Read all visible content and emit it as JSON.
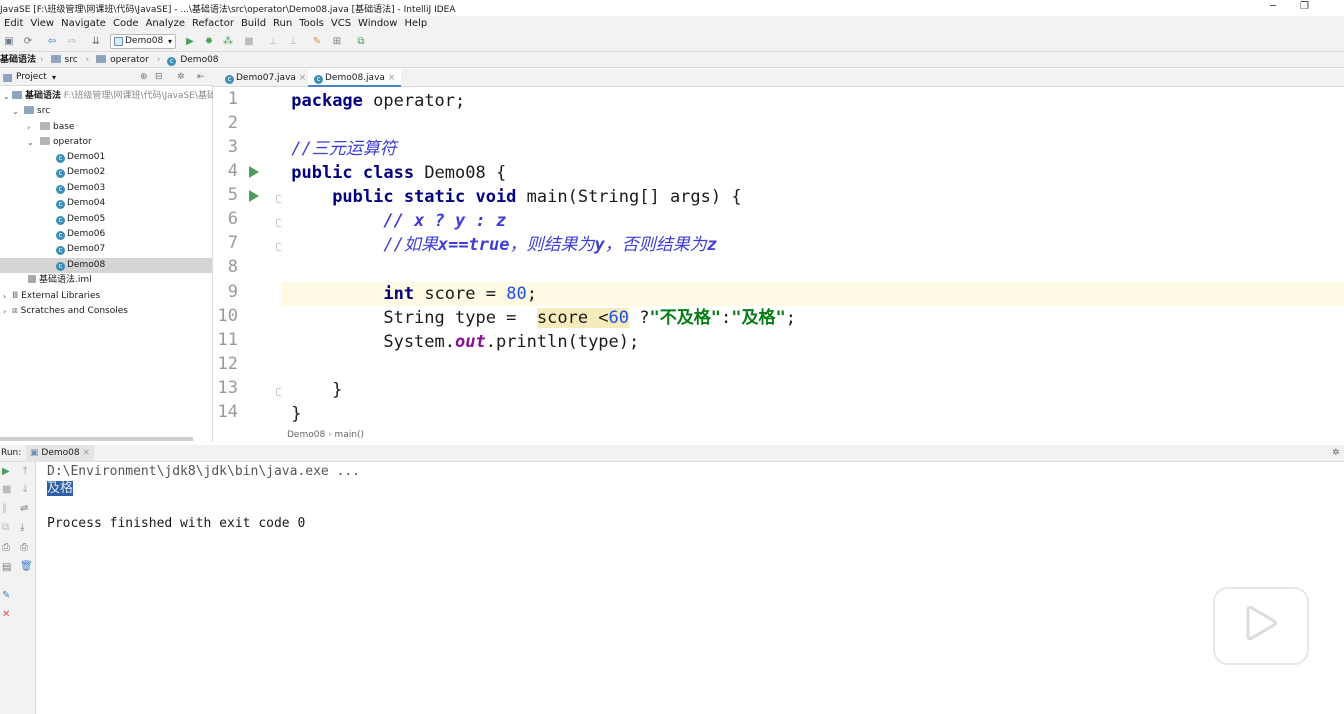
{
  "window": {
    "title": "JavaSE [F:\\班级管理\\网课班\\代码\\JavaSE] - ...\\基础语法\\src\\operator\\Demo08.java [基础语法] - IntelliJ IDEA",
    "minimize": "─",
    "restore": "❐"
  },
  "menu": [
    "Edit",
    "View",
    "Navigate",
    "Code",
    "Analyze",
    "Refactor",
    "Build",
    "Run",
    "Tools",
    "VCS",
    "Window",
    "Help"
  ],
  "toolbar": {
    "run_config": "Demo08"
  },
  "navbar": {
    "root": "基础语法",
    "src": "src",
    "pkg": "operator",
    "cls": "Demo08"
  },
  "project": {
    "header": "Project",
    "root_name": "基础语法",
    "root_path": "F:\\班级管理\\网课班\\代码\\JavaSE\\基础",
    "src": "src",
    "base": "base",
    "operator": "operator",
    "classes": [
      "Demo01",
      "Demo02",
      "Demo03",
      "Demo04",
      "Demo05",
      "Demo06",
      "Demo07",
      "Demo08"
    ],
    "iml": "基础语法.iml",
    "external": "External Libraries",
    "scratches": "Scratches and Consoles"
  },
  "tabs": [
    "Demo07.java",
    "Demo08.java"
  ],
  "editor": {
    "line_numbers": [
      "1",
      "2",
      "3",
      "4",
      "5",
      "6",
      "7",
      "8",
      "9",
      "10",
      "11",
      "12",
      "13",
      "14"
    ],
    "breadcrumb": [
      "Demo08",
      "main()"
    ]
  },
  "run": {
    "label": "Run:",
    "tab": "Demo08",
    "output": [
      "D:\\Environment\\jdk8\\jdk\\bin\\java.exe ...",
      "及格",
      "",
      "Process finished with exit code 0"
    ]
  },
  "colors": {
    "accent": "#4a86c7",
    "keyword": "#000080",
    "comment": "#3e3ed6",
    "string": "#067d17",
    "number": "#1750eb",
    "run_green": "#4c9e5a"
  }
}
